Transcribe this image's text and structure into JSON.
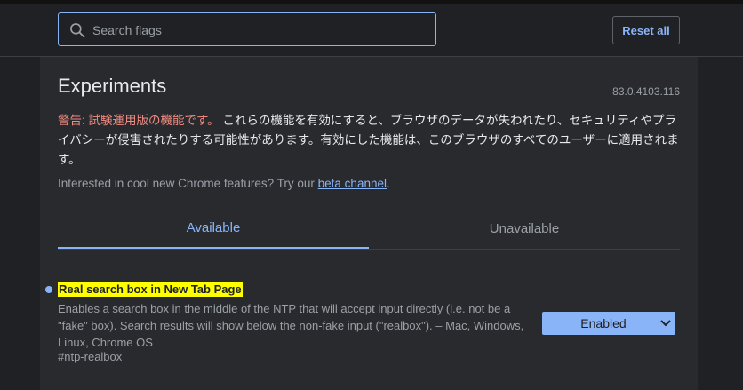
{
  "header": {
    "search_placeholder": "Search flags",
    "reset_label": "Reset all"
  },
  "page": {
    "title": "Experiments",
    "version": "83.0.4103.116",
    "warning_prefix": "警告: 試験運用版の機能です。",
    "warning_body": " これらの機能を有効にすると、ブラウザのデータが失われたり、セキュリティやプライバシーが侵害されたりする可能性があります。有効にした機能は、このブラウザのすべてのユーザーに適用されます。",
    "interest_text": "Interested in cool new Chrome features? Try our ",
    "beta_link": "beta channel",
    "interest_suffix": "."
  },
  "tabs": [
    {
      "label": "Available",
      "active": true
    },
    {
      "label": "Unavailable",
      "active": false
    }
  ],
  "flag": {
    "name": "Real search box in New Tab Page",
    "description": "Enables a search box in the middle of the NTP that will accept input directly (i.e. not be a \"fake\" box). Search results will show below the non-fake input (\"realbox\"). – Mac, Windows, Linux, Chrome OS",
    "link": "#ntp-realbox",
    "value": "Enabled"
  },
  "colors": {
    "accent": "#8ab4f8",
    "warning": "#f28b82",
    "highlight": "#ffff00",
    "background": "#202124",
    "panel": "#292a2d"
  },
  "icons": {
    "search": "search-icon",
    "dropdown": "chevron-down-icon"
  }
}
